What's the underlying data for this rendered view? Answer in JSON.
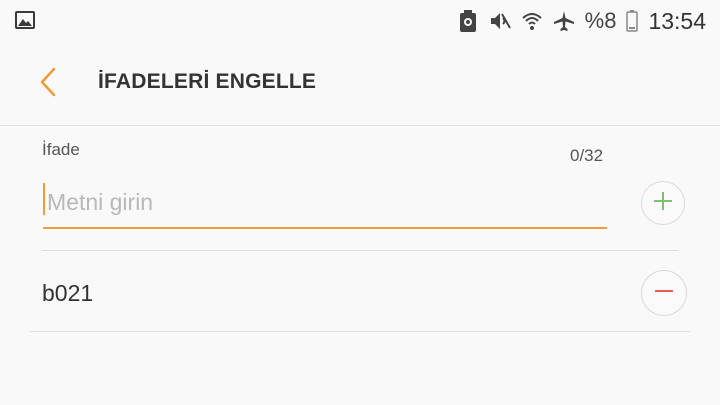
{
  "status_bar": {
    "battery_percent": "%8",
    "time": "13:54",
    "icons": [
      "gallery-icon",
      "battery-saver-icon",
      "mute-icon",
      "wifi-icon",
      "airplane-icon",
      "battery-icon"
    ]
  },
  "app_bar": {
    "title": "İFADELERİ ENGELLE",
    "back_icon": "chevron-left-icon"
  },
  "input": {
    "label": "İfade",
    "counter": "0/32",
    "placeholder": "Metni girin",
    "value": "",
    "add_icon": "plus-icon"
  },
  "phrases": [
    {
      "text": "b021",
      "remove_icon": "minus-icon"
    }
  ],
  "colors": {
    "accent": "#f19a3a",
    "add": "#7cc36b",
    "remove": "#e55a5a",
    "background": "#f9f9f9"
  }
}
